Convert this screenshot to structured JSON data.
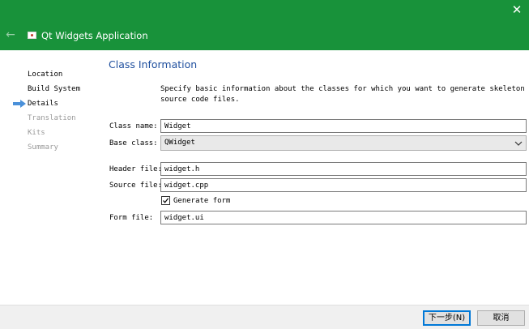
{
  "window": {
    "title": "Qt Widgets Application",
    "close_glyph": "✕",
    "back_glyph": "←"
  },
  "sidebar": {
    "steps": [
      {
        "label": "Location",
        "state": "done"
      },
      {
        "label": "Build System",
        "state": "done"
      },
      {
        "label": "Details",
        "state": "current"
      },
      {
        "label": "Translation",
        "state": "pending"
      },
      {
        "label": "Kits",
        "state": "pending"
      },
      {
        "label": "Summary",
        "state": "pending"
      }
    ]
  },
  "page": {
    "title": "Class Information",
    "description": "Specify basic information about the classes for which you want to generate skeleton source code files."
  },
  "form": {
    "class_name": {
      "label": "Class name:",
      "value": "Widget"
    },
    "base_class": {
      "label": "Base class:",
      "value": "QWidget"
    },
    "header_file": {
      "label": "Header file:",
      "value": "widget.h"
    },
    "source_file": {
      "label": "Source file:",
      "value": "widget.cpp"
    },
    "generate_form": {
      "label": "Generate form",
      "checked": true
    },
    "form_file": {
      "label": "Form file:",
      "value": "widget.ui"
    }
  },
  "footer": {
    "next_label": "下一步(N)",
    "cancel_label": "取消"
  },
  "colors": {
    "titlebar": "#18923a",
    "page_title": "#1f4f9e",
    "current_step_arrow": "#4a90d9",
    "default_button_border": "#0078d7"
  }
}
